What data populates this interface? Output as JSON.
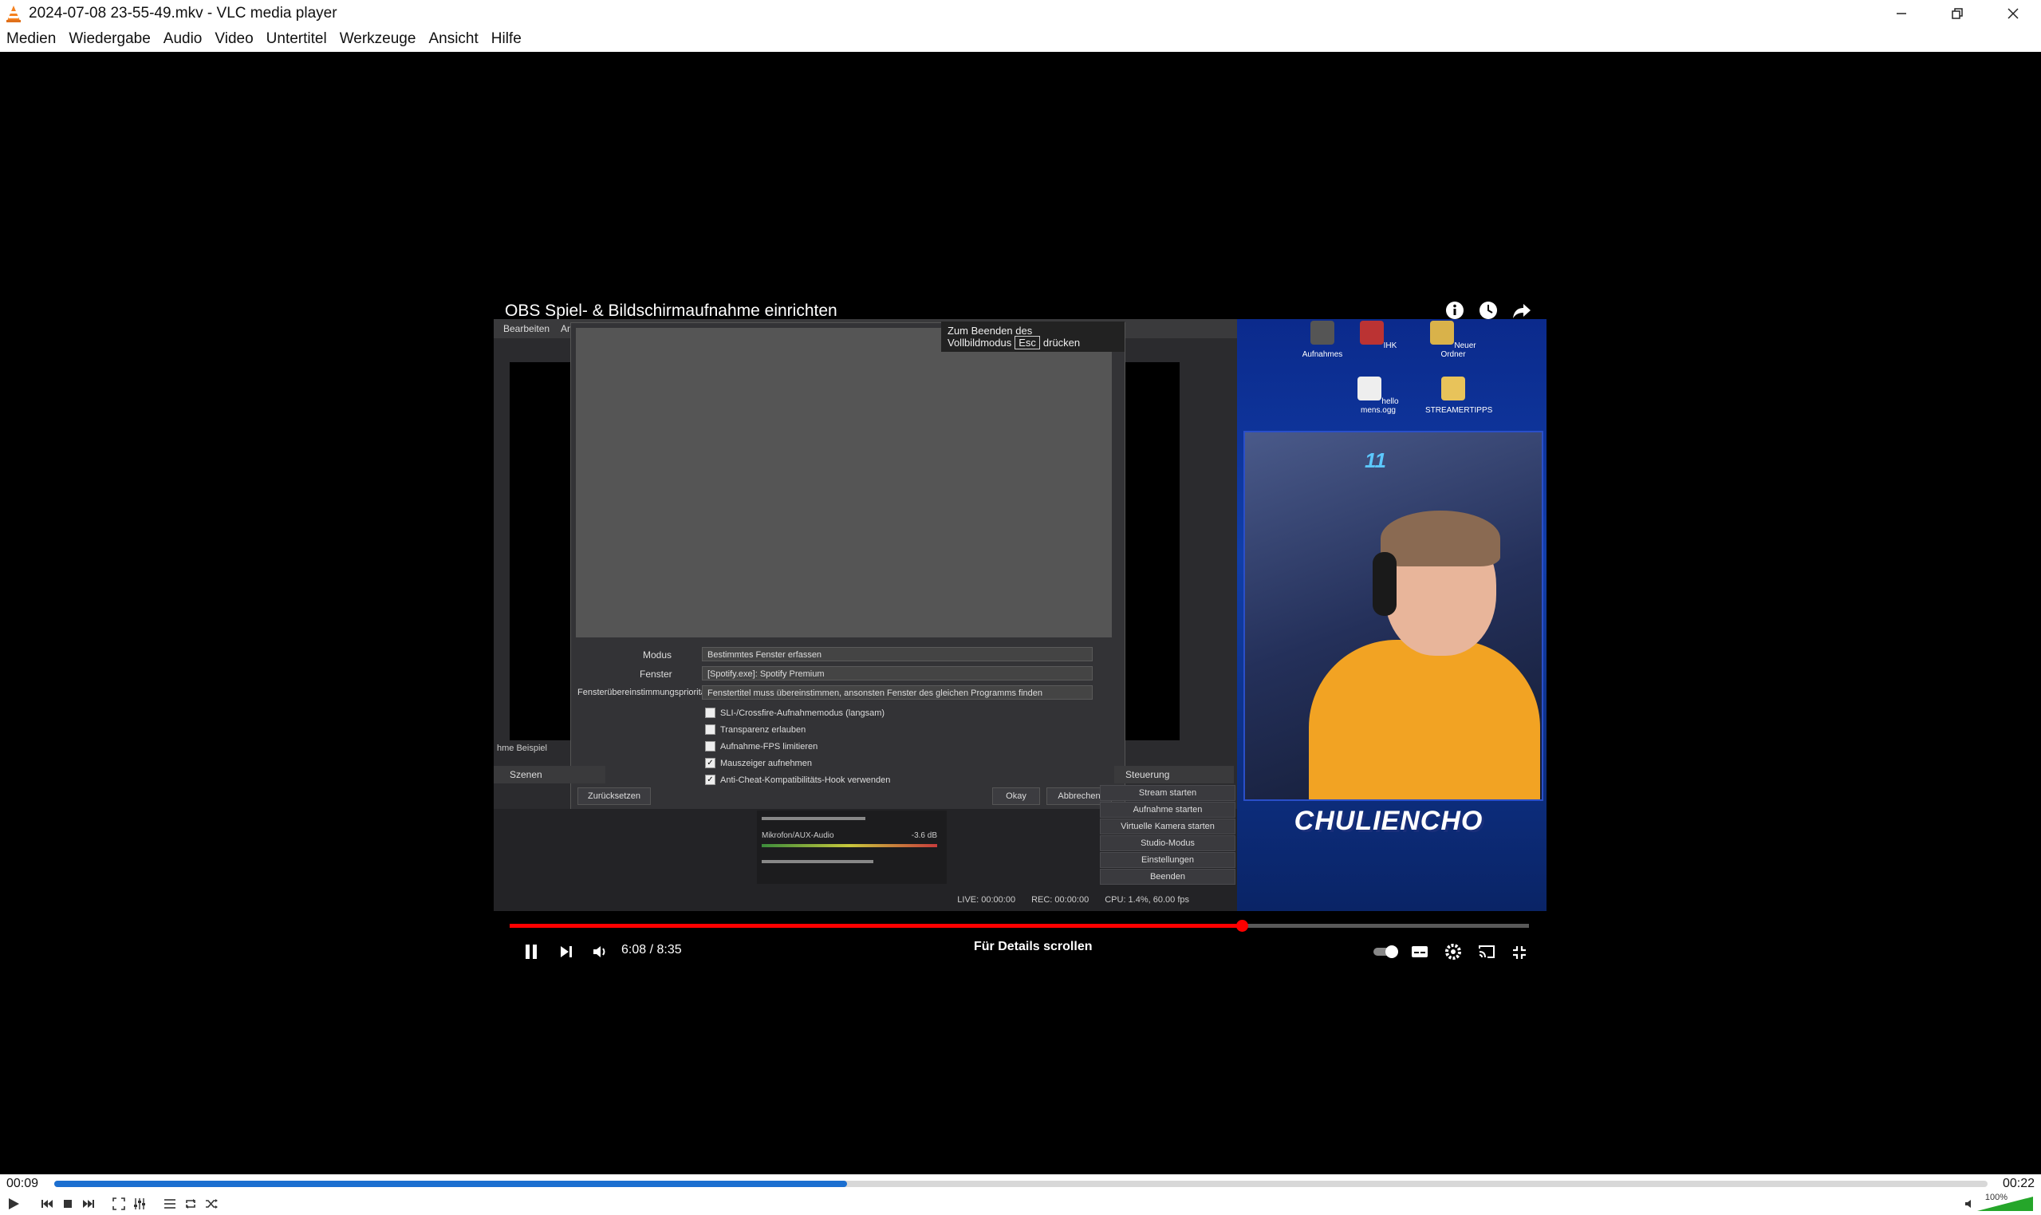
{
  "window": {
    "title": "2024-07-08 23-55-49.mkv - VLC media player",
    "minimize_icon": "minimize-icon",
    "restore_icon": "restore-icon",
    "close_icon": "close-icon"
  },
  "menu": [
    "Medien",
    "Wiedergabe",
    "Audio",
    "Video",
    "Untertitel",
    "Werkzeuge",
    "Ansicht",
    "Hilfe"
  ],
  "video_frame": {
    "video_title": "OBS Spiel- & Bildschirmaufnahme einrichten",
    "fullscreen_hint": {
      "before": "Zum Beenden des Vollbildmodus",
      "key": "Esc",
      "after": "drücken"
    },
    "obs": {
      "menu": [
        "Bearbeiten",
        "An"
      ],
      "fields": [
        {
          "label": "Modus",
          "value": "Bestimmtes Fenster erfassen"
        },
        {
          "label": "Fenster",
          "value": "[Spotify.exe]: Spotify Premium"
        },
        {
          "label": "Fensterübereinstimmungspriorität",
          "value": "Fenstertitel muss übereinstimmen, ansonsten Fenster des gleichen Programms finden"
        }
      ],
      "checkboxes": [
        {
          "label": "SLI-/Crossfire-Aufnahmemodus (langsam)",
          "checked": false
        },
        {
          "label": "Transparenz erlauben",
          "checked": false
        },
        {
          "label": "Aufnahme-FPS limitieren",
          "checked": false
        },
        {
          "label": "Mauszeiger aufnehmen",
          "checked": true
        },
        {
          "label": "Anti-Cheat-Kompatibilitäts-Hook verwenden",
          "checked": true
        }
      ],
      "reset_button": "Zurücksetzen",
      "ok_button": "Okay",
      "cancel_button": "Abbrechen",
      "scene_label": "hme Beispiel",
      "scenes_header": "Szenen",
      "controls_header": "Steuerung",
      "controls": [
        "Stream starten",
        "Aufnahme starten",
        "Virtuelle Kamera starten",
        "Studio-Modus",
        "Einstellungen",
        "Beenden"
      ],
      "mixer_label": "Mikrofon/AUX-Audio",
      "mixer_db": "-3.6 dB",
      "status": [
        "LIVE: 00:00:00",
        "REC: 00:00:00",
        "CPU: 1.4%, 60.00 fps"
      ]
    },
    "desktop_icons": [
      "Aufnahmes",
      "IHK",
      "Neuer Ordner",
      "hello mens.ogg",
      "STREAMERTIPPS"
    ],
    "webcam_name": "CHULIENCHO",
    "webcam_number": "11",
    "yt_time": "6:08 / 8:35",
    "yt_details": "Für Details scrollen",
    "yt_progress": 0.718
  },
  "player": {
    "elapsed": "00:09",
    "total": "00:22",
    "progress": 0.41,
    "volume_label": "100%",
    "volume": 1.0
  }
}
